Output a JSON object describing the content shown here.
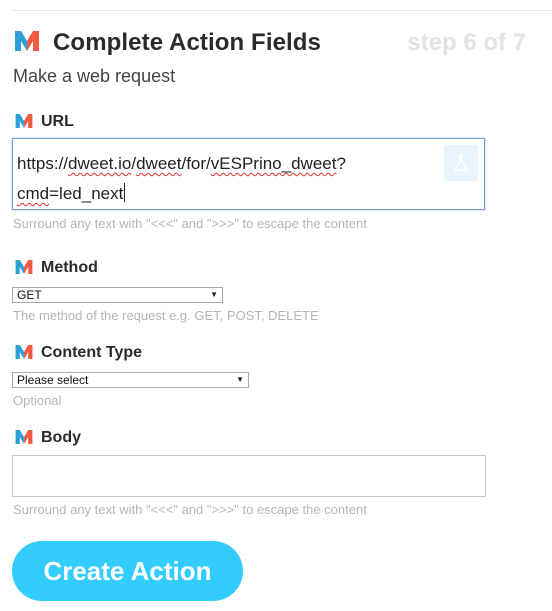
{
  "header": {
    "title": "Complete Action Fields",
    "step": "step 6 of 7",
    "logo_icon": "maker-m-icon"
  },
  "subtitle": "Make a web request",
  "url": {
    "label": "URL",
    "value_part1": "https://",
    "value_part2": "dweet.io",
    "value_part3": "/",
    "value_part4": "dweet",
    "value_part5": "/for/",
    "value_part6": "vESPrino_dweet",
    "value_part7": "?",
    "value_part8": "cmd",
    "value_part9": "=led_next",
    "hint": "Surround any text with \"<<<\" and \">>>\" to escape the content",
    "ingredient_icon": "flask-icon"
  },
  "method": {
    "label": "Method",
    "selected": "GET",
    "hint": "The method of the request e.g. GET, POST, DELETE"
  },
  "content_type": {
    "label": "Content Type",
    "selected": "Please select",
    "hint": "Optional"
  },
  "body": {
    "label": "Body",
    "value": "",
    "hint": "Surround any text with \"<<<\" and \">>>\" to escape the content"
  },
  "create_button": "Create Action",
  "colors": {
    "accent": "#33ccff",
    "maker_blue": "#2d9fd8",
    "maker_red": "#f25a43",
    "step_text": "#e3e3e3"
  }
}
